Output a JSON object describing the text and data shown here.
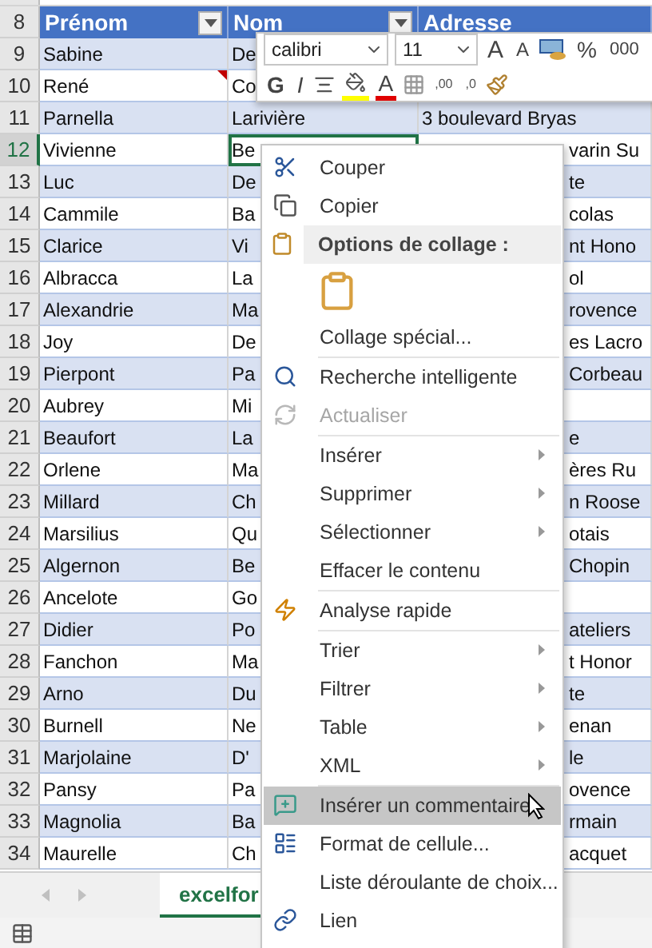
{
  "header": {
    "num": "8",
    "columns": [
      {
        "label": "Prénom",
        "filter": true
      },
      {
        "label": "Nom",
        "filter": true
      },
      {
        "label": "Adresse",
        "filter": false
      }
    ]
  },
  "rows": [
    {
      "num": "9",
      "prenom": "Sabine",
      "nom": "De",
      "selected": false,
      "comment": false
    },
    {
      "num": "10",
      "prenom": "René",
      "nom": "Co",
      "selected": false,
      "comment": true
    },
    {
      "num": "11",
      "prenom": "Parnella",
      "nom": "Larivière",
      "adresse": "3 boulevard Bryas",
      "selected": false,
      "comment": false
    },
    {
      "num": "12",
      "prenom": "Vivienne",
      "nom": "Be",
      "adresse": "varin Su",
      "selected": true,
      "comment": false
    },
    {
      "num": "13",
      "prenom": "Luc",
      "nom": "De",
      "adresse": "te",
      "selected": false,
      "comment": false
    },
    {
      "num": "14",
      "prenom": "Cammile",
      "nom": "Ba",
      "adresse": "colas",
      "selected": false,
      "comment": false
    },
    {
      "num": "15",
      "prenom": "Clarice",
      "nom": "Vi",
      "adresse": "nt Hono",
      "selected": false,
      "comment": false
    },
    {
      "num": "16",
      "prenom": "Albracca",
      "nom": "La",
      "adresse": "ol",
      "selected": false,
      "comment": false
    },
    {
      "num": "17",
      "prenom": "Alexandrie",
      "nom": "Ma",
      "adresse": "rovence",
      "selected": false,
      "comment": false
    },
    {
      "num": "18",
      "prenom": "Joy",
      "nom": "De",
      "adresse": "es Lacro",
      "selected": false,
      "comment": false
    },
    {
      "num": "19",
      "prenom": "Pierpont",
      "nom": "Pa",
      "adresse": "Corbeau",
      "selected": false,
      "comment": false
    },
    {
      "num": "20",
      "prenom": "Aubrey",
      "nom": "Mi",
      "selected": false,
      "comment": false
    },
    {
      "num": "21",
      "prenom": "Beaufort",
      "nom": "La",
      "adresse": "e",
      "selected": false,
      "comment": false
    },
    {
      "num": "22",
      "prenom": "Orlene",
      "nom": "Ma",
      "adresse": "ères Ru",
      "selected": false,
      "comment": false
    },
    {
      "num": "23",
      "prenom": "Millard",
      "nom": "Ch",
      "adresse": "n Roose",
      "selected": false,
      "comment": false
    },
    {
      "num": "24",
      "prenom": "Marsilius",
      "nom": "Qu",
      "adresse": "otais",
      "selected": false,
      "comment": false
    },
    {
      "num": "25",
      "prenom": "Algernon",
      "nom": "Be",
      "adresse": "Chopin",
      "selected": false,
      "comment": false
    },
    {
      "num": "26",
      "prenom": "Ancelote",
      "nom": "Go",
      "selected": false,
      "comment": false
    },
    {
      "num": "27",
      "prenom": "Didier",
      "nom": "Po",
      "adresse": "ateliers",
      "selected": false,
      "comment": false
    },
    {
      "num": "28",
      "prenom": "Fanchon",
      "nom": "Ma",
      "adresse": "t Honor",
      "selected": false,
      "comment": false
    },
    {
      "num": "29",
      "prenom": "Arno",
      "nom": "Du",
      "adresse": "te",
      "selected": false,
      "comment": false
    },
    {
      "num": "30",
      "prenom": "Burnell",
      "nom": "Ne",
      "adresse": "enan",
      "selected": false,
      "comment": false
    },
    {
      "num": "31",
      "prenom": "Marjolaine",
      "nom": "D'",
      "adresse": "le",
      "selected": false,
      "comment": false
    },
    {
      "num": "32",
      "prenom": "Pansy",
      "nom": "Pa",
      "adresse": "ovence",
      "selected": false,
      "comment": false
    },
    {
      "num": "33",
      "prenom": "Magnolia",
      "nom": "Ba",
      "adresse": "rmain",
      "selected": false,
      "comment": false
    },
    {
      "num": "34",
      "prenom": "Maurelle",
      "nom": "Ch",
      "adresse": "acquet",
      "selected": false,
      "comment": false
    }
  ],
  "mini_toolbar": {
    "font": "calibri",
    "size": "11",
    "grow": "A",
    "shrink": "A",
    "percent": "%",
    "thousands": "000",
    "bold": "G",
    "italic": "I",
    "font_color": "A",
    "decimals": [
      ",00",
      ",0"
    ]
  },
  "menu": {
    "items": [
      {
        "kind": "item",
        "label": "Couper",
        "disabled": false,
        "submenu": false,
        "selected": false
      },
      {
        "kind": "item",
        "label": "Copier",
        "disabled": false,
        "submenu": false,
        "selected": false
      },
      {
        "kind": "header",
        "label": "Options de collage :"
      },
      {
        "kind": "paste"
      },
      {
        "kind": "item",
        "label": "Collage spécial...",
        "disabled": false,
        "submenu": false,
        "selected": false
      },
      {
        "kind": "item",
        "label": "Recherche intelligente",
        "disabled": false,
        "submenu": false,
        "selected": false
      },
      {
        "kind": "item",
        "label": "Actualiser",
        "disabled": true,
        "submenu": false,
        "selected": false
      },
      {
        "kind": "item",
        "label": "Insérer",
        "disabled": false,
        "submenu": true,
        "selected": false
      },
      {
        "kind": "item",
        "label": "Supprimer",
        "disabled": false,
        "submenu": true,
        "selected": false
      },
      {
        "kind": "item",
        "label": "Sélectionner",
        "disabled": false,
        "submenu": true,
        "selected": false
      },
      {
        "kind": "item",
        "label": "Effacer le contenu",
        "disabled": false,
        "submenu": false,
        "selected": false
      },
      {
        "kind": "item",
        "label": "Analyse rapide",
        "disabled": false,
        "submenu": false,
        "selected": false
      },
      {
        "kind": "item",
        "label": "Trier",
        "disabled": false,
        "submenu": true,
        "selected": false
      },
      {
        "kind": "item",
        "label": "Filtrer",
        "disabled": false,
        "submenu": true,
        "selected": false
      },
      {
        "kind": "item",
        "label": "Table",
        "disabled": false,
        "submenu": true,
        "selected": false
      },
      {
        "kind": "item",
        "label": "XML",
        "disabled": false,
        "submenu": true,
        "selected": false
      },
      {
        "kind": "item",
        "label": "Insérer un commentaire",
        "disabled": false,
        "submenu": false,
        "selected": true
      },
      {
        "kind": "item",
        "label": "Format de cellule...",
        "disabled": false,
        "submenu": false,
        "selected": false
      },
      {
        "kind": "item",
        "label": "Liste déroulante de choix...",
        "disabled": false,
        "submenu": false,
        "selected": false
      },
      {
        "kind": "item",
        "label": "Lien",
        "disabled": false,
        "submenu": false,
        "selected": false
      }
    ]
  },
  "sheet_tabs": [
    {
      "label": "excelfor",
      "selected": true
    }
  ]
}
